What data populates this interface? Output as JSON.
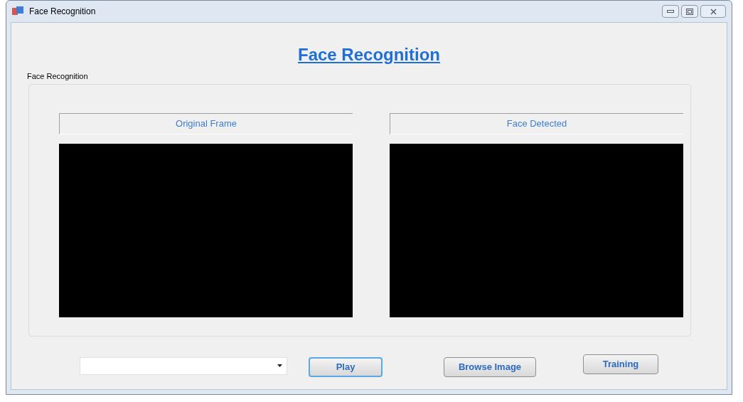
{
  "window": {
    "title": "Face Recognition"
  },
  "heading": "Face Recognition",
  "group": {
    "title": "Face Recognition",
    "panels": [
      {
        "label": "Original Frame"
      },
      {
        "label": "Face Detected"
      }
    ]
  },
  "source_dropdown": {
    "expanded": false
  },
  "buttons": [
    {
      "label": "Play",
      "focused": true
    },
    {
      "label": "Browse Image",
      "focused": false
    },
    {
      "label": "Training",
      "focused": false
    }
  ]
}
